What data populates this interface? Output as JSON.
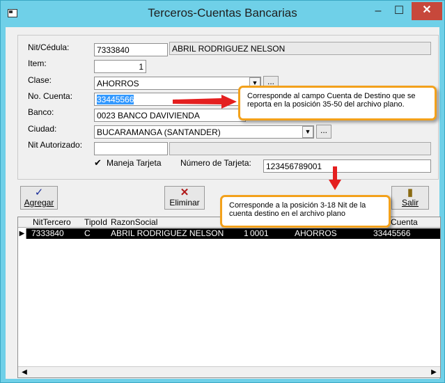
{
  "window": {
    "title": "Terceros-Cuentas Bancarias",
    "minimize_label": "–",
    "maximize_label": "☐",
    "close_label": "✕"
  },
  "form": {
    "nit_label": "Nit/Cédula:",
    "nit_value": "7333840",
    "nombre_value": "ABRIL RODRIGUEZ NELSON",
    "item_label": "Item:",
    "item_value": "1",
    "clase_label": "Clase:",
    "clase_value": "AHORROS",
    "cuenta_label": "No. Cuenta:",
    "cuenta_value": "33445566",
    "banco_label": "Banco:",
    "banco_value": "0023  BANCO DAVIVIENDA",
    "ciudad_label": "Ciudad:",
    "ciudad_value": "BUCARAMANGA  (SANTANDER)",
    "nit_autorizado_label": "Nit Autorizado:",
    "nit_autorizado_value": "",
    "maneja_tarjeta_label": "Maneja Tarjeta",
    "maneja_tarjeta_checked": true,
    "numero_tarjeta_label": "Número de Tarjeta:",
    "numero_tarjeta_value": "123456789001",
    "dots_label": "..."
  },
  "toolbar": {
    "agregar_label": "Agregar",
    "eliminar_label": "Eliminar",
    "salir_label": "Salir"
  },
  "grid": {
    "headers": [
      "NitTercero",
      "TipoId",
      "RazonSocial",
      "Cuenta"
    ],
    "row": {
      "nit": "7333840",
      "tipo": "C",
      "razon": "ABRIL RODRIGUEZ NELSON",
      "item": "1",
      "banco": "0001",
      "clase": "AHORROS",
      "cuenta": "33445566"
    }
  },
  "callouts": {
    "cuenta": "Corresponde al campo Cuenta de Destino que se reporta en la posición 35-50 del archivo plano.",
    "nit": "Corresponde a la posición 3-18 Nit de la cuenta destino en el archivo plano"
  },
  "colors": {
    "titlebar": "#6fd0e8",
    "close": "#c7483b",
    "callout_border": "#f3a11b",
    "arrow": "#e41f1f",
    "selection": "#3399ff"
  }
}
